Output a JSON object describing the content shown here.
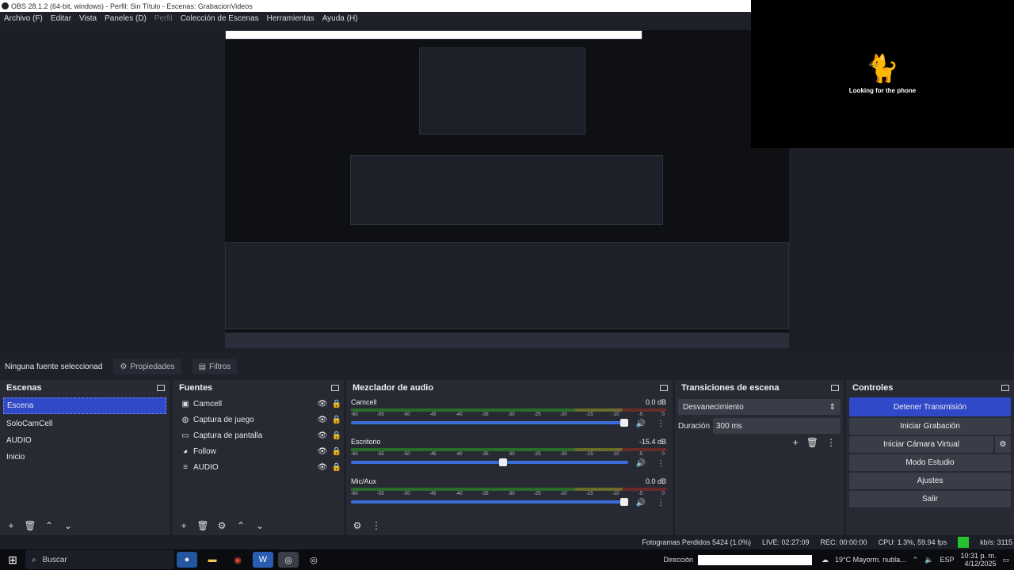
{
  "window": {
    "title": "OBS 28.1.2 (64-bit, windows) - Perfil: Sin Título - Escenas: GrabacionVideos"
  },
  "menu": {
    "items": [
      "Archivo (F)",
      "Editar",
      "Vista",
      "Paneles (D)",
      "Perfil",
      "Colección de Escenas",
      "Herramientas",
      "Ayuda (H)"
    ]
  },
  "overlay": {
    "caption": "Looking for the phone"
  },
  "source_bar": {
    "none_selected": "Ninguna fuente seleccionad",
    "properties": "Propiedades",
    "filters": "Filtros"
  },
  "scenes": {
    "title": "Escenas",
    "items": [
      "Escena",
      "SoloCamCell",
      "AUDIO",
      "Inicio"
    ]
  },
  "sources": {
    "title": "Fuentes",
    "items": [
      {
        "name": "Camcell",
        "icon": "camera-icon"
      },
      {
        "name": "Captura de juego",
        "icon": "gamepad-icon"
      },
      {
        "name": "Captura de pantalla",
        "icon": "monitor-icon"
      },
      {
        "name": "Follow",
        "icon": "globe-icon"
      },
      {
        "name": "AUDIO",
        "icon": "list-icon"
      }
    ]
  },
  "mixer": {
    "title": "Mezclador de audio",
    "ticks": [
      "-60",
      "-55",
      "-50",
      "-45",
      "-40",
      "-35",
      "-30",
      "-25",
      "-20",
      "-15",
      "-10",
      "-5",
      "0"
    ],
    "channels": [
      {
        "name": "Camcell",
        "db": "0.0 dB",
        "fader": 1.0
      },
      {
        "name": "Escritorio",
        "db": "-15.4 dB",
        "fader": 0.55
      },
      {
        "name": "Mic/Aux",
        "db": "0.0 dB",
        "fader": 1.0
      }
    ]
  },
  "transitions": {
    "title": "Transiciones de escena",
    "selected": "Desvanecimiento",
    "duration_label": "Duración",
    "duration_value": "300 ms"
  },
  "controls": {
    "title": "Controles",
    "stop_stream": "Detener Transmisión",
    "start_recording": "Iniciar Grabación",
    "start_vcam": "Iniciar Cámara Virtual",
    "studio_mode": "Modo Estudio",
    "settings": "Ajustes",
    "exit": "Salir"
  },
  "status": {
    "dropped": "Fotogramas Perdidos 5424 (1.0%)",
    "live": "LIVE: 02:27:09",
    "rec": "REC: 00:00:00",
    "cpu": "CPU: 1.3%, 59.94 fps",
    "kbs": "kb/s: 3115"
  },
  "taskbar": {
    "search_placeholder": "Buscar",
    "address_label": "Dirección",
    "weather": "19°C  Mayorm. nubla...",
    "lang": "ESP",
    "time": "10:31 p. m.",
    "date": "4/12/2025"
  },
  "colors": {
    "accent": "#2f49c9",
    "live_green": "#26c12e",
    "panel": "#272a33"
  }
}
